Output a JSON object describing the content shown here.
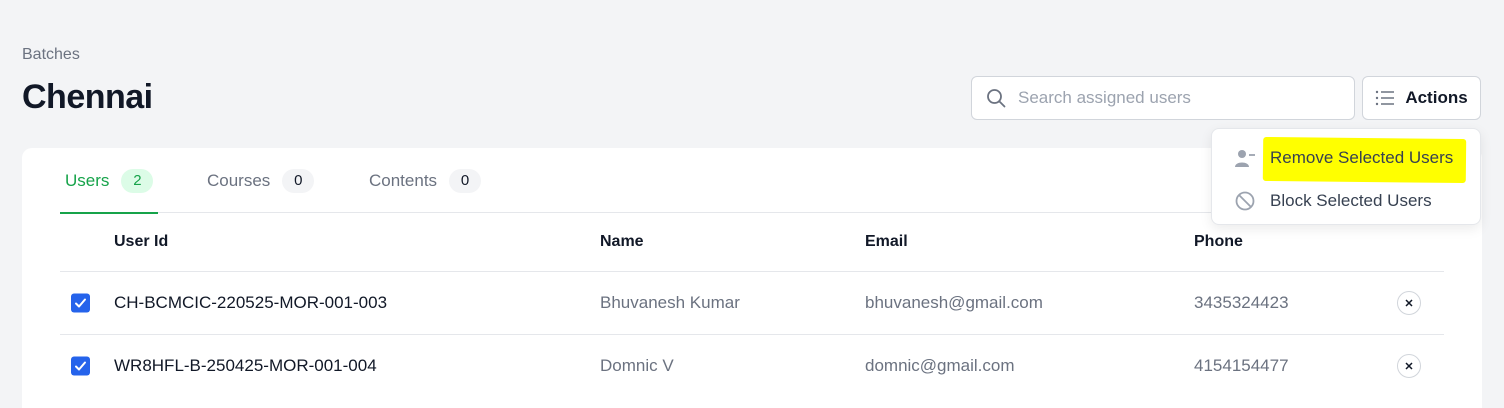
{
  "breadcrumb": "Batches",
  "page_title": "Chennai",
  "search": {
    "placeholder": "Search assigned users",
    "value": ""
  },
  "actions_button": {
    "label": "Actions",
    "icon": "list-icon"
  },
  "tabs": [
    {
      "label": "Users",
      "count": "2",
      "active": true
    },
    {
      "label": "Courses",
      "count": "0",
      "active": false
    },
    {
      "label": "Contents",
      "count": "0",
      "active": false
    }
  ],
  "table": {
    "columns": [
      "User Id",
      "Name",
      "Email",
      "Phone"
    ],
    "rows": [
      {
        "checked": true,
        "user_id": "CH-BCMCIC-220525-MOR-001-003",
        "name": "Bhuvanesh Kumar",
        "email": "bhuvanesh@gmail.com",
        "phone": "3435324423"
      },
      {
        "checked": true,
        "user_id": "WR8HFL-B-250425-MOR-001-004",
        "name": "Domnic V",
        "email": "domnic@gmail.com",
        "phone": "4154154477"
      }
    ]
  },
  "actions_menu": {
    "items": [
      {
        "label": "Remove Selected Users",
        "icon": "user-minus-icon",
        "highlighted": true
      },
      {
        "label": "Block Selected Users",
        "icon": "block-icon",
        "highlighted": false
      }
    ]
  },
  "colors": {
    "accent_green": "#16a34a",
    "badge_green_bg": "#dcfce7",
    "checkbox_blue": "#2563eb",
    "highlight_yellow": "#ffff00",
    "page_bg": "#f3f4f6"
  }
}
